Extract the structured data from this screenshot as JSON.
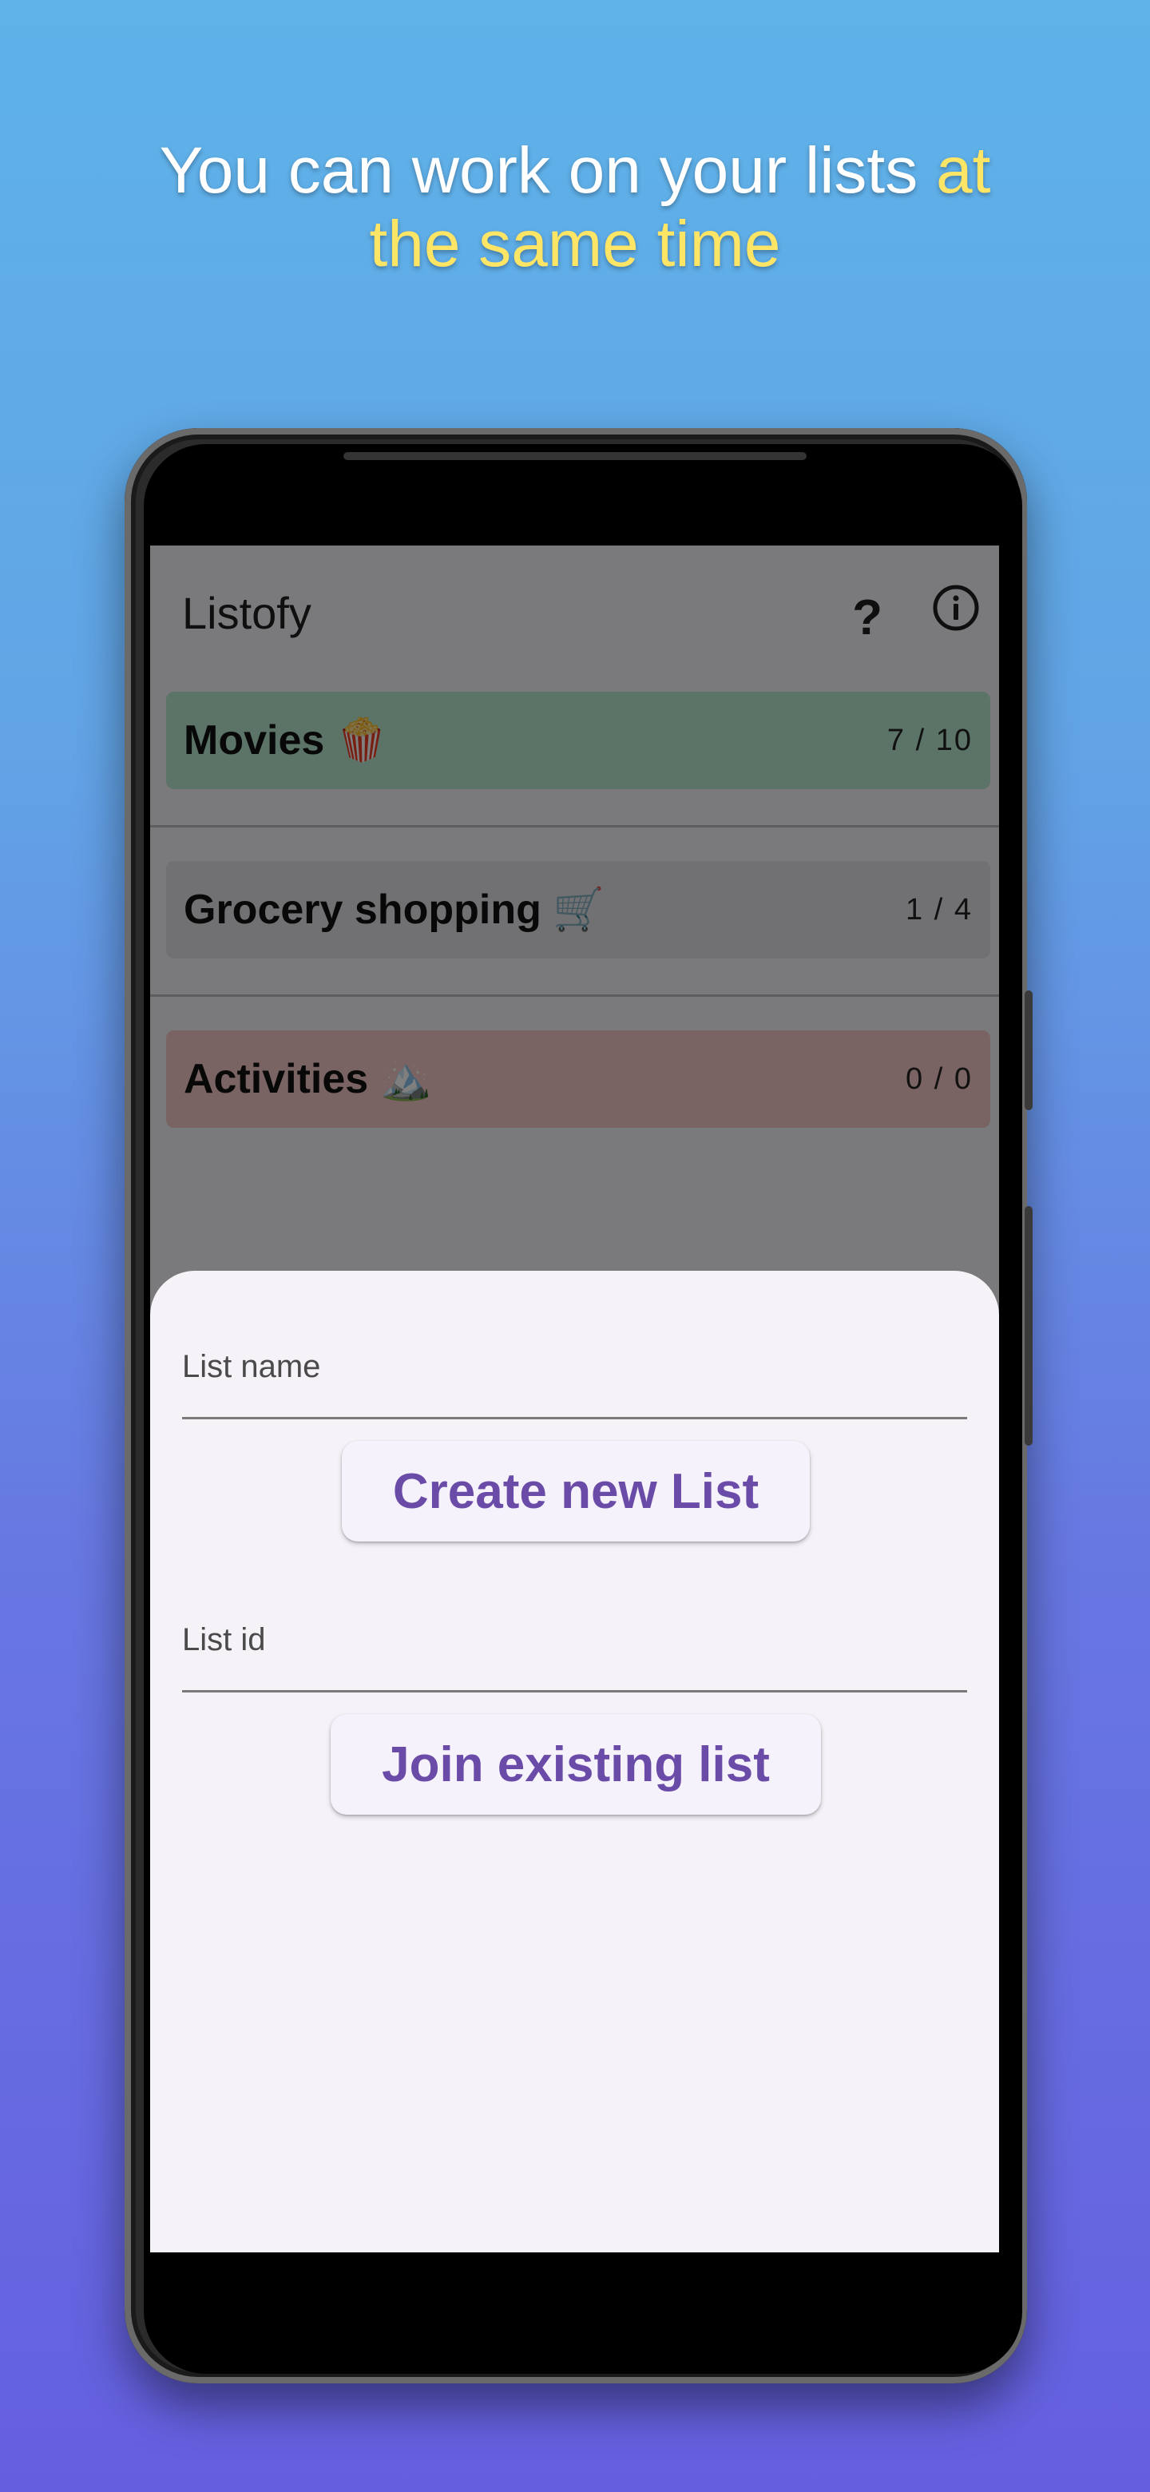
{
  "headline": {
    "part1": "You can work on your lists ",
    "highlight_line1": "at",
    "highlight_line2": "the same time"
  },
  "app": {
    "title": "Listofy",
    "help_label": "?",
    "info_icon": "info-icon"
  },
  "lists": [
    {
      "name": "Movies",
      "emoji": "🍿",
      "count": "7 / 10",
      "color": "#b6e8cf"
    },
    {
      "name": "Grocery shopping",
      "emoji": "🛒",
      "count": "1 / 4",
      "color": "#e2e0e4"
    },
    {
      "name": "Activities",
      "emoji": "🏔️",
      "count": "0 / 0",
      "color": "#f4c8c6"
    }
  ],
  "sheet": {
    "list_name_label": "List name",
    "create_button": "Create new List",
    "list_id_label": "List id",
    "join_button": "Join existing list"
  },
  "colors": {
    "accent": "#6a4ba8",
    "highlight": "#ffe566"
  }
}
